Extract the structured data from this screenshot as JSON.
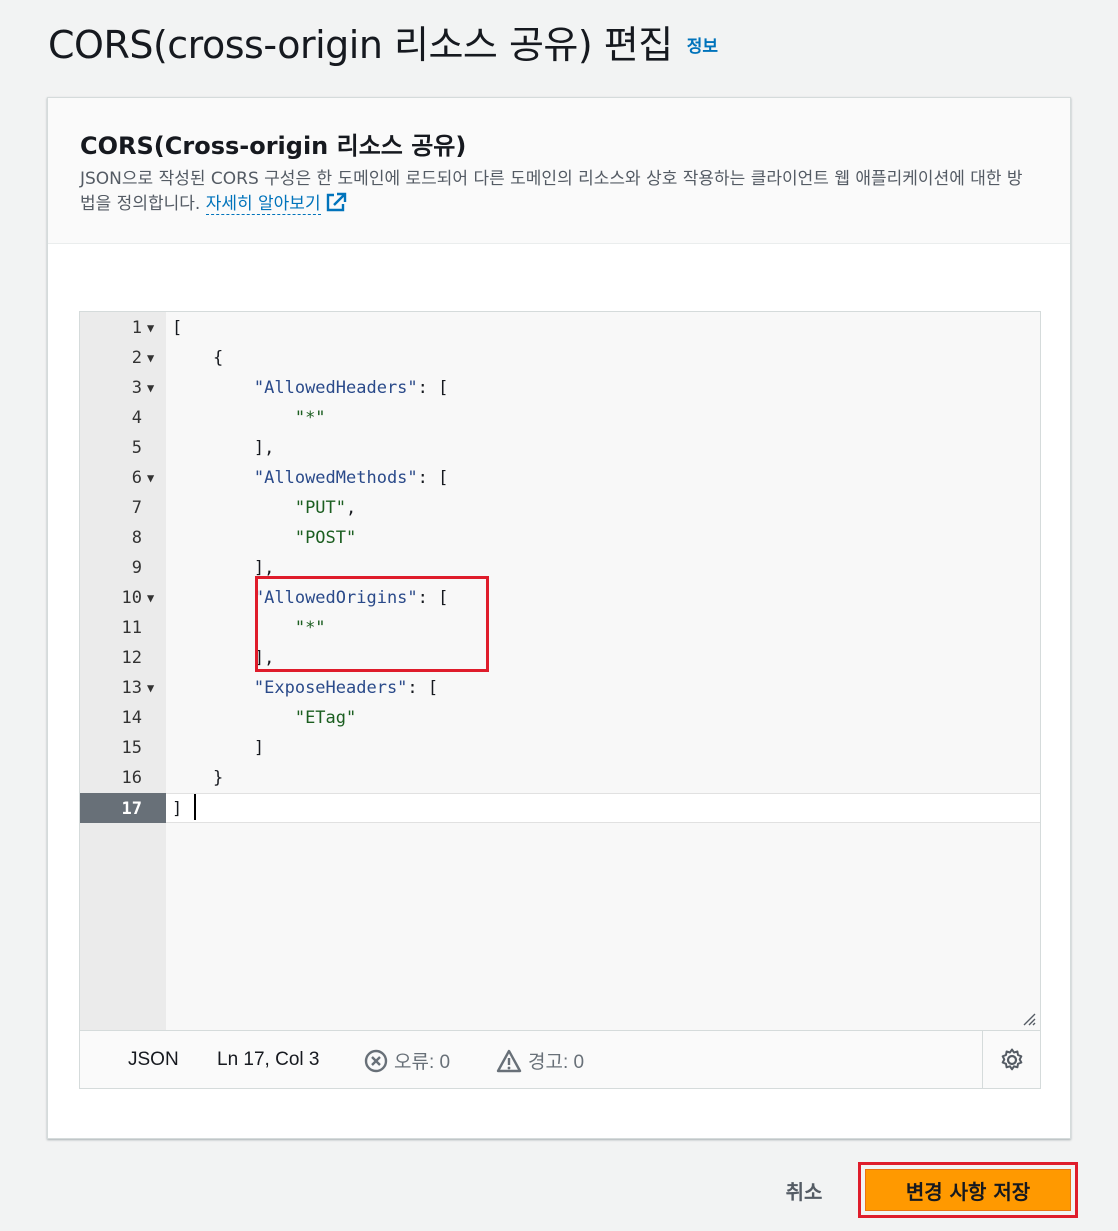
{
  "page": {
    "title": "CORS(cross-origin 리소스 공유) 편집",
    "info_link": "정보"
  },
  "panel": {
    "heading": "CORS(Cross-origin 리소스 공유)",
    "description": "JSON으로 작성된 CORS 구성은 한 도메인에 로드되어 다른 도메인의 리소스와 상호 작용하는 클라이언트 웹 애플리케이션에 대한 방법을 정의합니다.",
    "learn_more": "자세히 알아보기"
  },
  "editor": {
    "lines": [
      {
        "n": "1",
        "fold": true,
        "text": "["
      },
      {
        "n": "2",
        "fold": true,
        "text": "    {"
      },
      {
        "n": "3",
        "fold": true,
        "key": "\"AllowedHeaders\"",
        "rest": ": [",
        "indent": "        "
      },
      {
        "n": "4",
        "fold": false,
        "str": "\"*\"",
        "rest": "",
        "indent": "            "
      },
      {
        "n": "5",
        "fold": false,
        "text": "        ],"
      },
      {
        "n": "6",
        "fold": true,
        "key": "\"AllowedMethods\"",
        "rest": ": [",
        "indent": "        "
      },
      {
        "n": "7",
        "fold": false,
        "str": "\"PUT\"",
        "rest": ",",
        "indent": "            "
      },
      {
        "n": "8",
        "fold": false,
        "str": "\"POST\"",
        "rest": "",
        "indent": "            "
      },
      {
        "n": "9",
        "fold": false,
        "text": "        ],"
      },
      {
        "n": "10",
        "fold": true,
        "key": "\"AllowedOrigins\"",
        "rest": ": [",
        "indent": "        "
      },
      {
        "n": "11",
        "fold": false,
        "str": "\"*\"",
        "rest": "",
        "indent": "            "
      },
      {
        "n": "12",
        "fold": false,
        "text": "        ],"
      },
      {
        "n": "13",
        "fold": true,
        "key": "\"ExposeHeaders\"",
        "rest": ": [",
        "indent": "        "
      },
      {
        "n": "14",
        "fold": false,
        "str": "\"ETag\"",
        "rest": "",
        "indent": "            "
      },
      {
        "n": "15",
        "fold": false,
        "text": "        ]"
      },
      {
        "n": "16",
        "fold": false,
        "text": "    }"
      },
      {
        "n": "17",
        "fold": false,
        "text": "]",
        "active": true
      }
    ],
    "status": {
      "language": "JSON",
      "position": "Ln 17, Col 3",
      "errors": "오류: 0",
      "warnings": "경고: 0"
    }
  },
  "actions": {
    "cancel": "취소",
    "save": "변경 사항 저장"
  },
  "colors": {
    "accent": "#ff9900",
    "link": "#0073bb",
    "highlight": "#df1c2b"
  }
}
